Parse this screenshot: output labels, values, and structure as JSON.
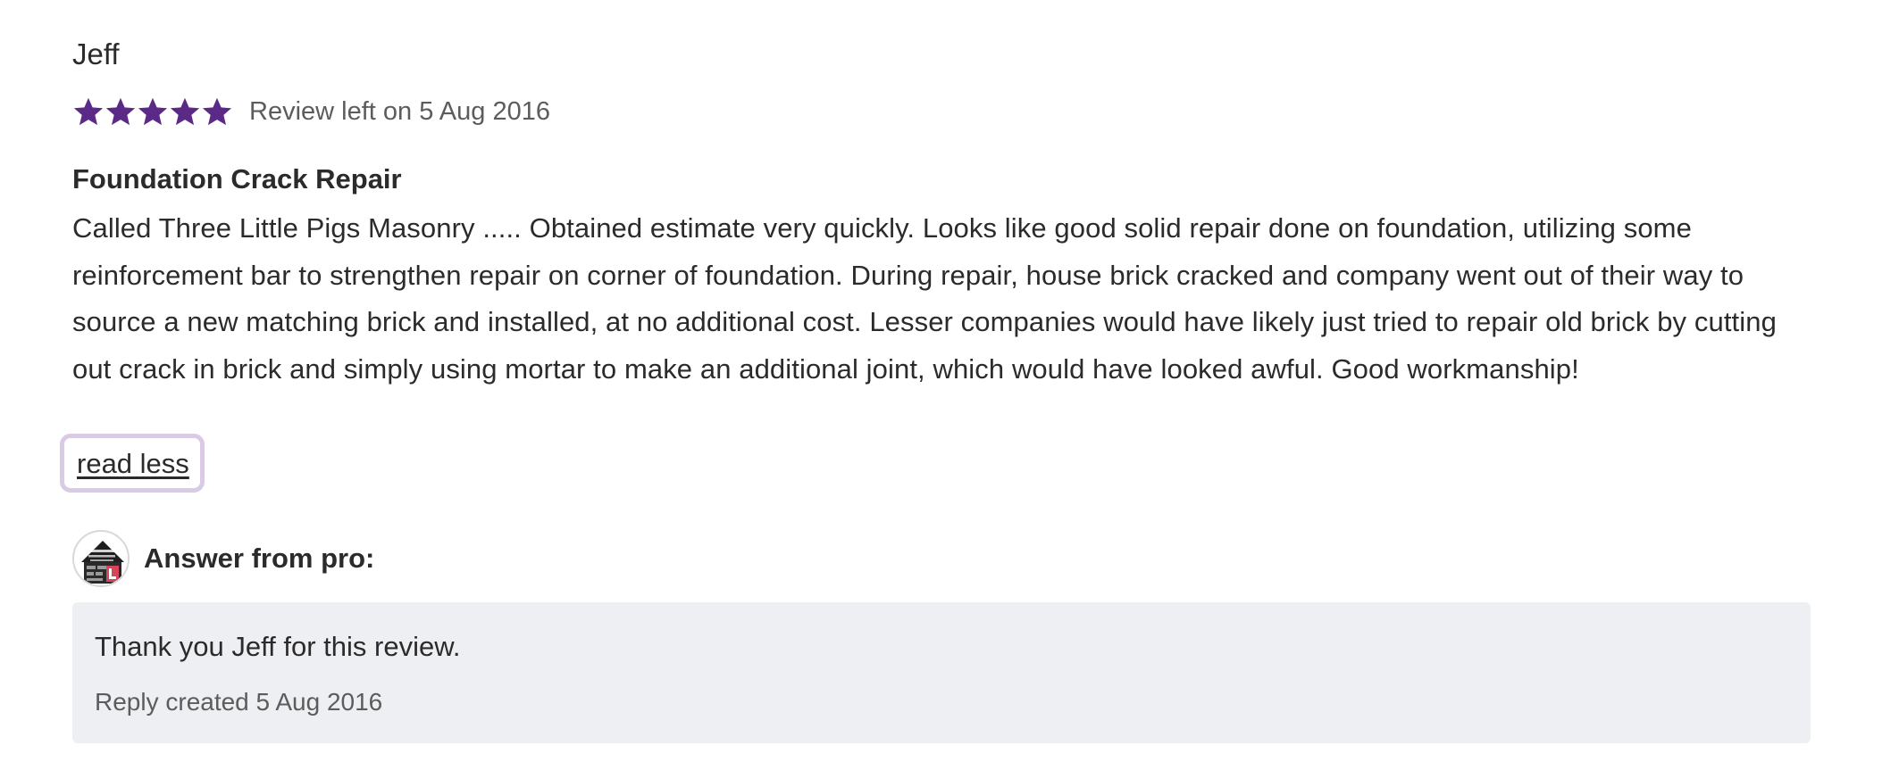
{
  "review": {
    "reviewer_name": "Jeff",
    "rating": 5,
    "rating_max": 5,
    "star_color": "#5b2a86",
    "date_text": "Review left on 5 Aug 2016",
    "title": "Foundation Crack Repair",
    "body": "Called Three Little Pigs Masonry ..... Obtained estimate very quickly. Looks like good solid repair done on foundation, utilizing some reinforcement bar to strengthen repair on corner of foundation. During repair, house brick cracked and company went out of their way to source a new matching brick and installed, at no additional cost. Lesser companies would have likely just tried to repair old brick by cutting out crack in brick and simply using mortar to make an additional joint, which would have looked awful. Good workmanship!",
    "read_less_label": "read less",
    "focus_ring_color": "#d9cbe3"
  },
  "answer": {
    "avatar_icon": "three-little-pigs-masonry-logo",
    "label": "Answer from pro:",
    "reply_text": "Thank you Jeff for this review.",
    "reply_date": "Reply created 5 Aug 2016",
    "reply_bg_color": "#eeeff3"
  }
}
